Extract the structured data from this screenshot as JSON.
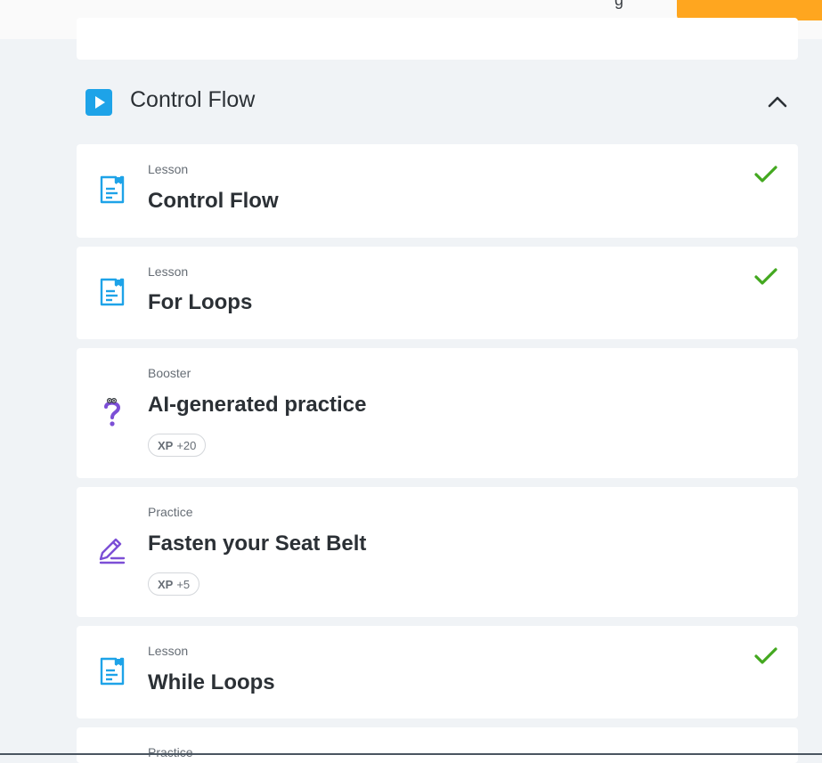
{
  "section": {
    "title": "Control Flow"
  },
  "items": [
    {
      "type": "Lesson",
      "title": "Control Flow",
      "completed": true,
      "icon": "lesson-document-icon"
    },
    {
      "type": "Lesson",
      "title": "For Loops",
      "completed": true,
      "icon": "lesson-document-icon"
    },
    {
      "type": "Booster",
      "title": "AI-generated practice",
      "completed": false,
      "icon": "question-mark-character-icon",
      "xp_label": "XP",
      "xp_value": "+20"
    },
    {
      "type": "Practice",
      "title": "Fasten your Seat Belt",
      "completed": false,
      "icon": "pencil-practice-icon",
      "xp_label": "XP",
      "xp_value": "+5"
    },
    {
      "type": "Lesson",
      "title": "While Loops",
      "completed": true,
      "icon": "lesson-document-icon"
    },
    {
      "type": "Practice",
      "title": "",
      "completed": false,
      "icon": "pencil-practice-icon"
    }
  ],
  "colors": {
    "accent_blue": "#1ea3e8",
    "check_green": "#43a81f",
    "practice_purple": "#7c4fd6",
    "header_orange": "#ffa61f"
  }
}
